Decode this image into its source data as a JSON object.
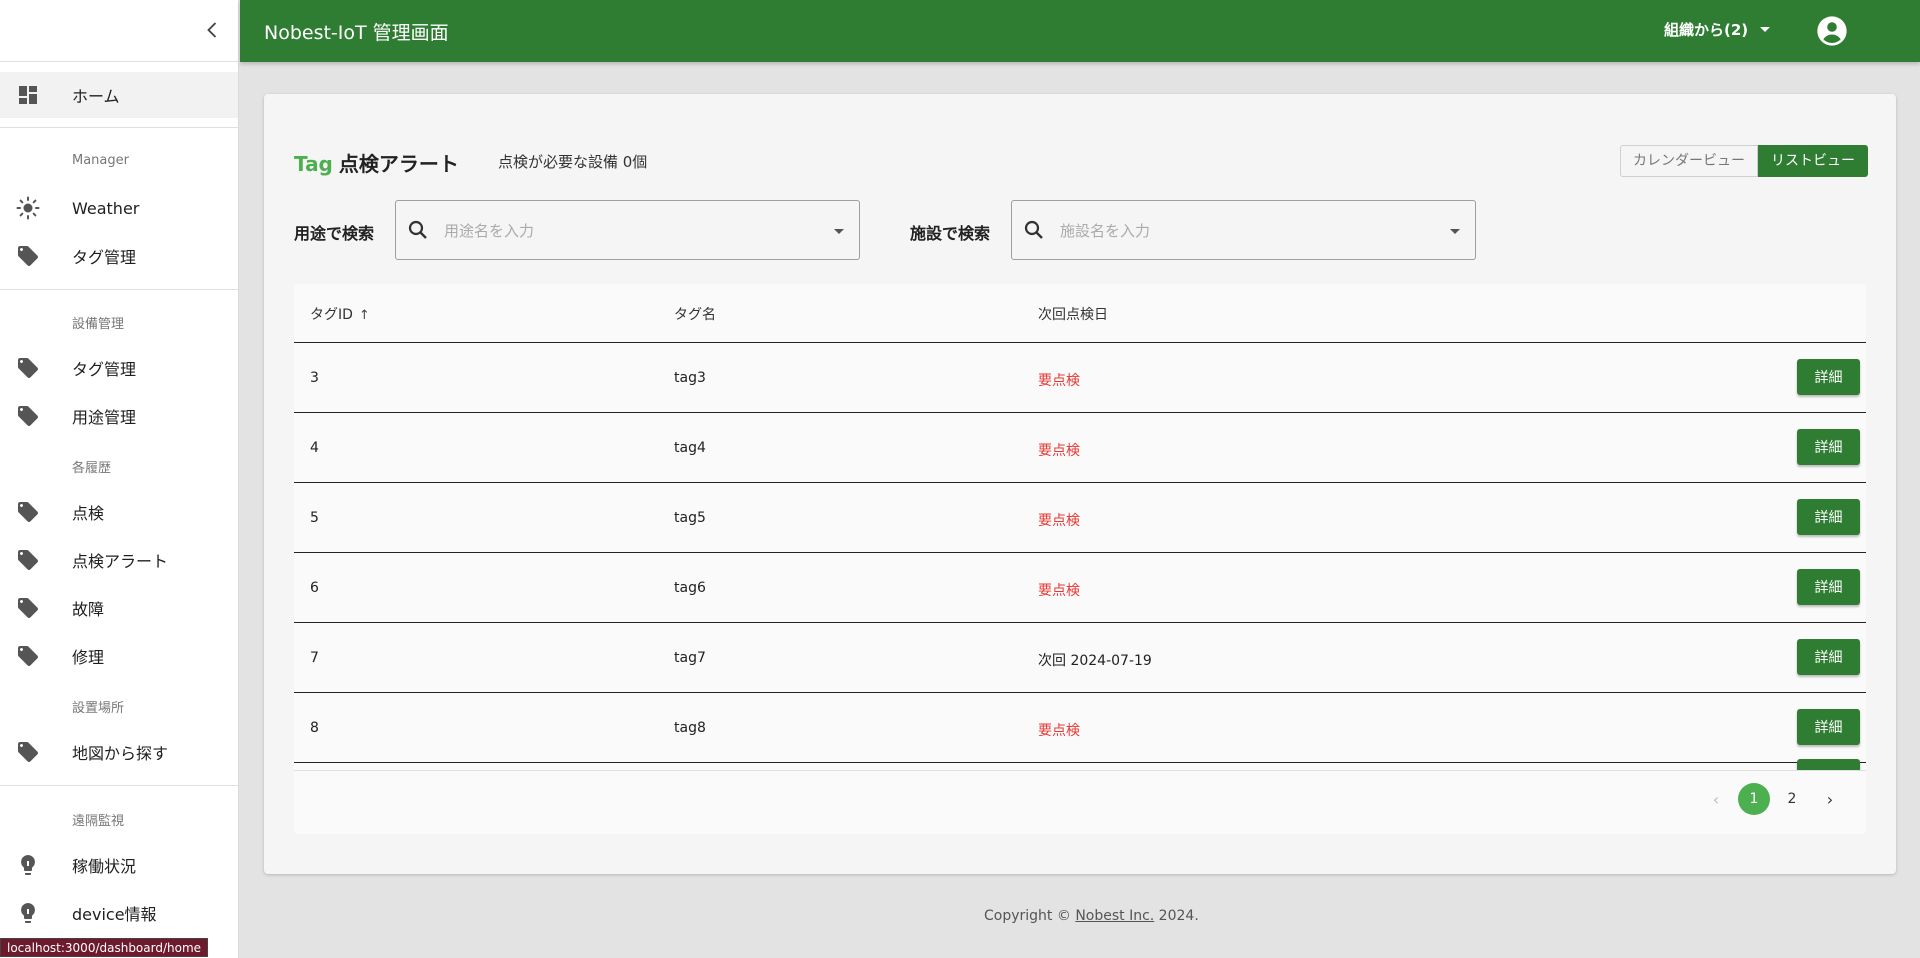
{
  "header": {
    "title": "Nobest-IoT 管理画面",
    "org_label": "組織から(2)",
    "account_icon": "account-circle-icon",
    "color": "#2e7d32"
  },
  "sidebar": {
    "collapse_icon": "chevron-left-icon",
    "home": {
      "label": "ホーム",
      "icon": "dashboard-icon"
    },
    "sections": {
      "manager": "Manager",
      "equipment": "設備管理",
      "history": "各履歴",
      "location": "設置場所",
      "remote": "遠隔監視"
    },
    "items": [
      {
        "label": "Weather",
        "icon": "sun-icon"
      },
      {
        "label": "タグ管理",
        "icon": "tag-icon"
      },
      {
        "label": "タグ管理",
        "icon": "tag-icon"
      },
      {
        "label": "用途管理",
        "icon": "tag-icon"
      },
      {
        "label": "点検",
        "icon": "tag-icon"
      },
      {
        "label": "点検アラート",
        "icon": "tag-icon"
      },
      {
        "label": "故障",
        "icon": "tag-icon"
      },
      {
        "label": "修理",
        "icon": "tag-icon"
      },
      {
        "label": "地図から探す",
        "icon": "tag-icon"
      },
      {
        "label": "稼働状況",
        "icon": "lightbulb-icon"
      },
      {
        "label": "device情報",
        "icon": "lightbulb-icon"
      }
    ]
  },
  "main": {
    "title_tag": "Tag",
    "title": "点検アラート",
    "required_count": "点検が必要な設備 0個",
    "view_toggle": {
      "calendar": "カレンダービュー",
      "list": "リストビュー",
      "selected": "リストビュー"
    },
    "filters": [
      {
        "label": "用途で検索",
        "placeholder": "用途名を入力"
      },
      {
        "label": "施設で検索",
        "placeholder": "施設名を入力"
      }
    ],
    "table": {
      "columns": [
        "タグID",
        "タグ名",
        "次回点検日"
      ],
      "sort_indicator": "↑",
      "detail_label": "詳細",
      "rows": [
        {
          "id": "3",
          "name": "tag3",
          "next": "要点検"
        },
        {
          "id": "4",
          "name": "tag4",
          "next": "要点検"
        },
        {
          "id": "5",
          "name": "tag5",
          "next": "要点検"
        },
        {
          "id": "6",
          "name": "tag6",
          "next": "要点検"
        },
        {
          "id": "7",
          "name": "tag7",
          "next": "次回 2024-07-19"
        },
        {
          "id": "8",
          "name": "tag8",
          "next": "要点検"
        }
      ]
    },
    "pagination": {
      "prev": "‹",
      "pages": [
        "1",
        "2"
      ],
      "current": "1",
      "next": "›"
    }
  },
  "footer": {
    "prefix": "Copyright © ",
    "company": "Nobest Inc.",
    "suffix": " 2024."
  },
  "status_url": "localhost:3000/dashboard/home"
}
